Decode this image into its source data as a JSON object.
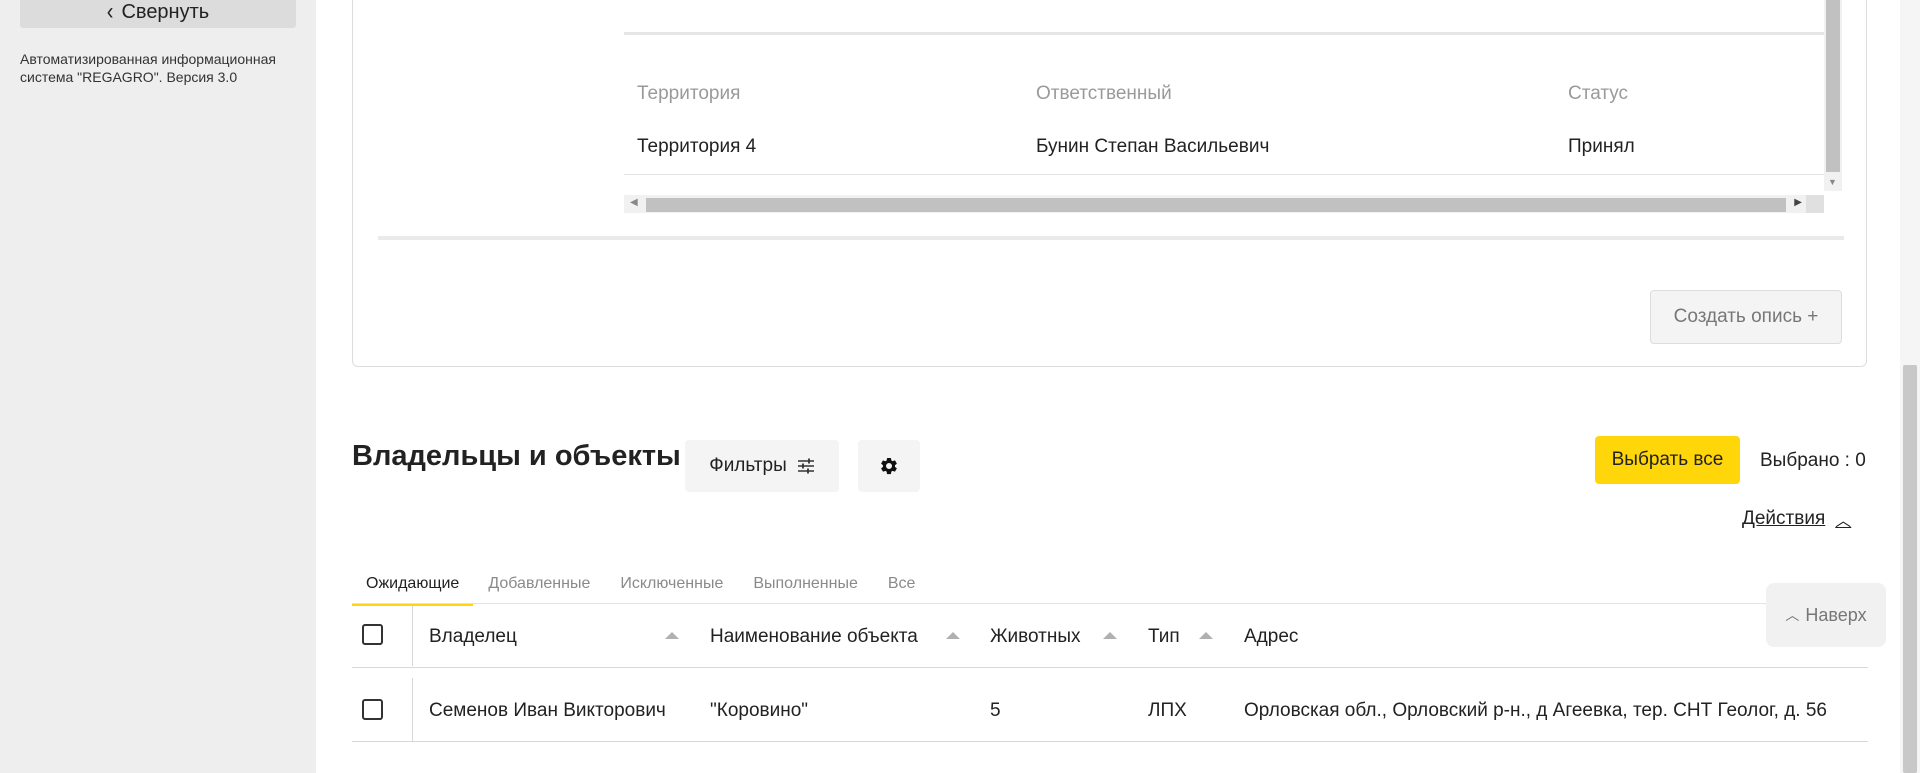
{
  "sidebar": {
    "collapse_label": "Свернуть",
    "system_info": "Автоматизированная информационная система \"REGAGRO\". Версия 3.0"
  },
  "inventory": {
    "columns": [
      "Территория",
      "Ответственный",
      "Статус"
    ],
    "rows": [
      [
        "Территория 4",
        "Бунин Степан Васильевич",
        "Принял"
      ]
    ],
    "create_button": "Создать опись +"
  },
  "owners": {
    "title": "Владельцы и объекты",
    "filters_label": "Фильтры",
    "select_all_label": "Выбрать все",
    "selected_count": "Выбрано : 0",
    "actions_label": "Действия",
    "tabs": [
      "Ожидающие",
      "Добавленные",
      "Исключенные",
      "Выполненные",
      "Все"
    ],
    "active_tab": "Ожидающие",
    "columns": [
      "Владелец",
      "Наименование объекта",
      "Животных",
      "Тип",
      "Адрес"
    ],
    "rows": [
      [
        "Семенов Иван Викторович",
        "\"Коровино\"",
        "5",
        "ЛПХ",
        "Орловская обл., Орловский р-н., д Агеевка, тер. СНТ Геолог, д. 56"
      ]
    ]
  },
  "back_to_top": "Наверх",
  "colors": {
    "accent": "#ffd60a",
    "sidebar_bg": "#eeeeee"
  }
}
